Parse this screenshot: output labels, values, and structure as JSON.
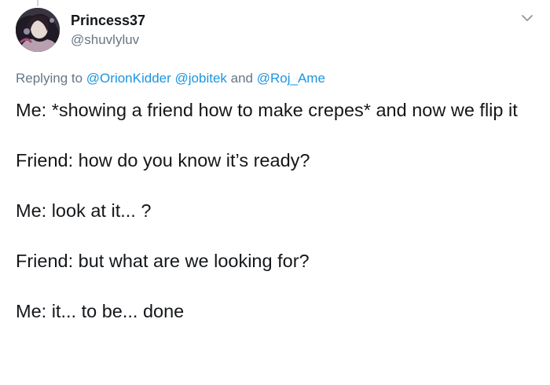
{
  "author": {
    "display_name": "Princess37",
    "handle": "@shuvlyluv",
    "avatar_icon": "profile-photo"
  },
  "reply": {
    "prefix": "Replying to",
    "mentions": [
      "@OrionKidder",
      "@jobitek",
      "@Roj_Ame"
    ],
    "separator_space": " ",
    "conjunction": "and"
  },
  "menu": {
    "icon": "chevron-down-icon"
  },
  "tweet": {
    "paragraphs": [
      "Me: *showing a friend how to make crepes* and now we flip it",
      "Friend: how do you know it’s ready?",
      "Me: look at it... ?",
      "Friend: but what are we looking for?",
      "Me: it... to be... done"
    ]
  },
  "colors": {
    "text": "#14171a",
    "secondary": "#657786",
    "link": "#1b95e0"
  }
}
